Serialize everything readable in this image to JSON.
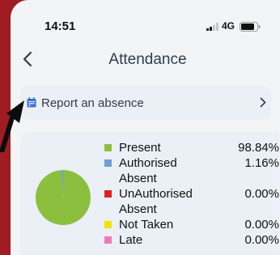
{
  "status": {
    "time": "14:51",
    "network": "4G"
  },
  "header": {
    "title": "Attendance"
  },
  "report": {
    "label": "Report an absence"
  },
  "legend": [
    {
      "label": "Present",
      "value": "98.84%",
      "color": "#8dbf3f",
      "fraction": 0.9884
    },
    {
      "label": "Authorised Absent",
      "value": "1.16%",
      "color": "#6f9fd8",
      "fraction": 0.0116
    },
    {
      "label": "UnAuthorised Absent",
      "value": "0.00%",
      "color": "#e02020",
      "fraction": 0
    },
    {
      "label": "Not Taken",
      "value": "0.00%",
      "color": "#f2e600",
      "fraction": 0
    },
    {
      "label": "Late",
      "value": "0.00%",
      "color": "#f07ab5",
      "fraction": 0
    }
  ]
}
